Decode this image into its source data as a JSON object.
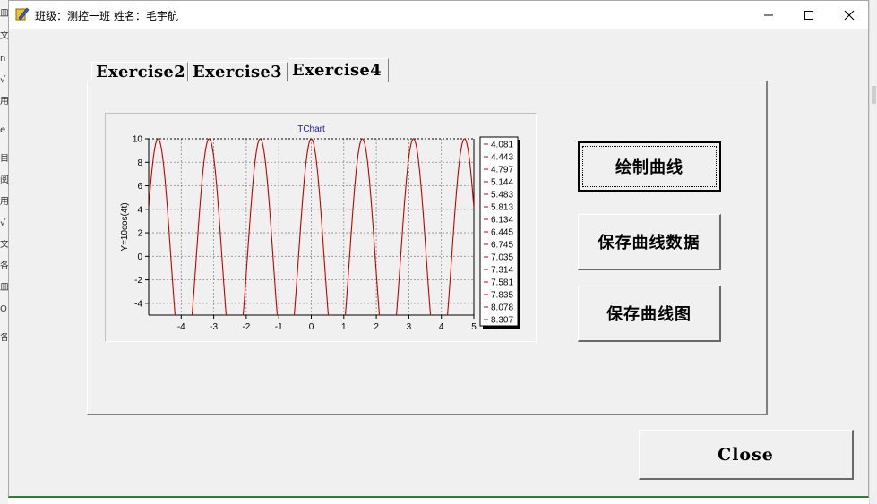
{
  "window": {
    "title": "班级：测控一班 姓名：毛宇航",
    "minimize_symbol": "—",
    "maximize_symbol": "☐",
    "close_symbol": "✕"
  },
  "background_fragments": [
    "皿",
    "文",
    "n",
    "√",
    "用",
    "e",
    "目",
    "阅",
    "用",
    "√",
    "文",
    "各",
    "皿",
    "O",
    "各"
  ],
  "tabs": [
    {
      "label": "Exercise2",
      "active": false
    },
    {
      "label": "Exercise3",
      "active": false
    },
    {
      "label": "Exercise4",
      "active": true
    }
  ],
  "buttons": {
    "draw": "绘制曲线",
    "save_data": "保存曲线数据",
    "save_image": "保存曲线图",
    "close": "Close"
  },
  "chart_data": {
    "type": "line",
    "title": "TChart",
    "ylabel": "Y=10cos(4t)",
    "xlabel": "",
    "function": "10*cos(4*t)",
    "xlim": [
      -5,
      5
    ],
    "ylim": [
      -5,
      10
    ],
    "x_ticks": [
      "-4",
      "-3",
      "-2",
      "-1",
      "0",
      "1",
      "2",
      "3",
      "4",
      "5"
    ],
    "y_ticks": [
      "10",
      "8",
      "6",
      "4",
      "2",
      "0",
      "-2",
      "-4"
    ],
    "grid": true,
    "line_color": "#c00000",
    "legend": [
      "4.081",
      "4.443",
      "4.797",
      "5.144",
      "5.483",
      "5.813",
      "6.134",
      "6.445",
      "6.745",
      "7.035",
      "7.314",
      "7.581",
      "7.835",
      "8.078",
      "8.307"
    ],
    "legend_placement": "right"
  }
}
